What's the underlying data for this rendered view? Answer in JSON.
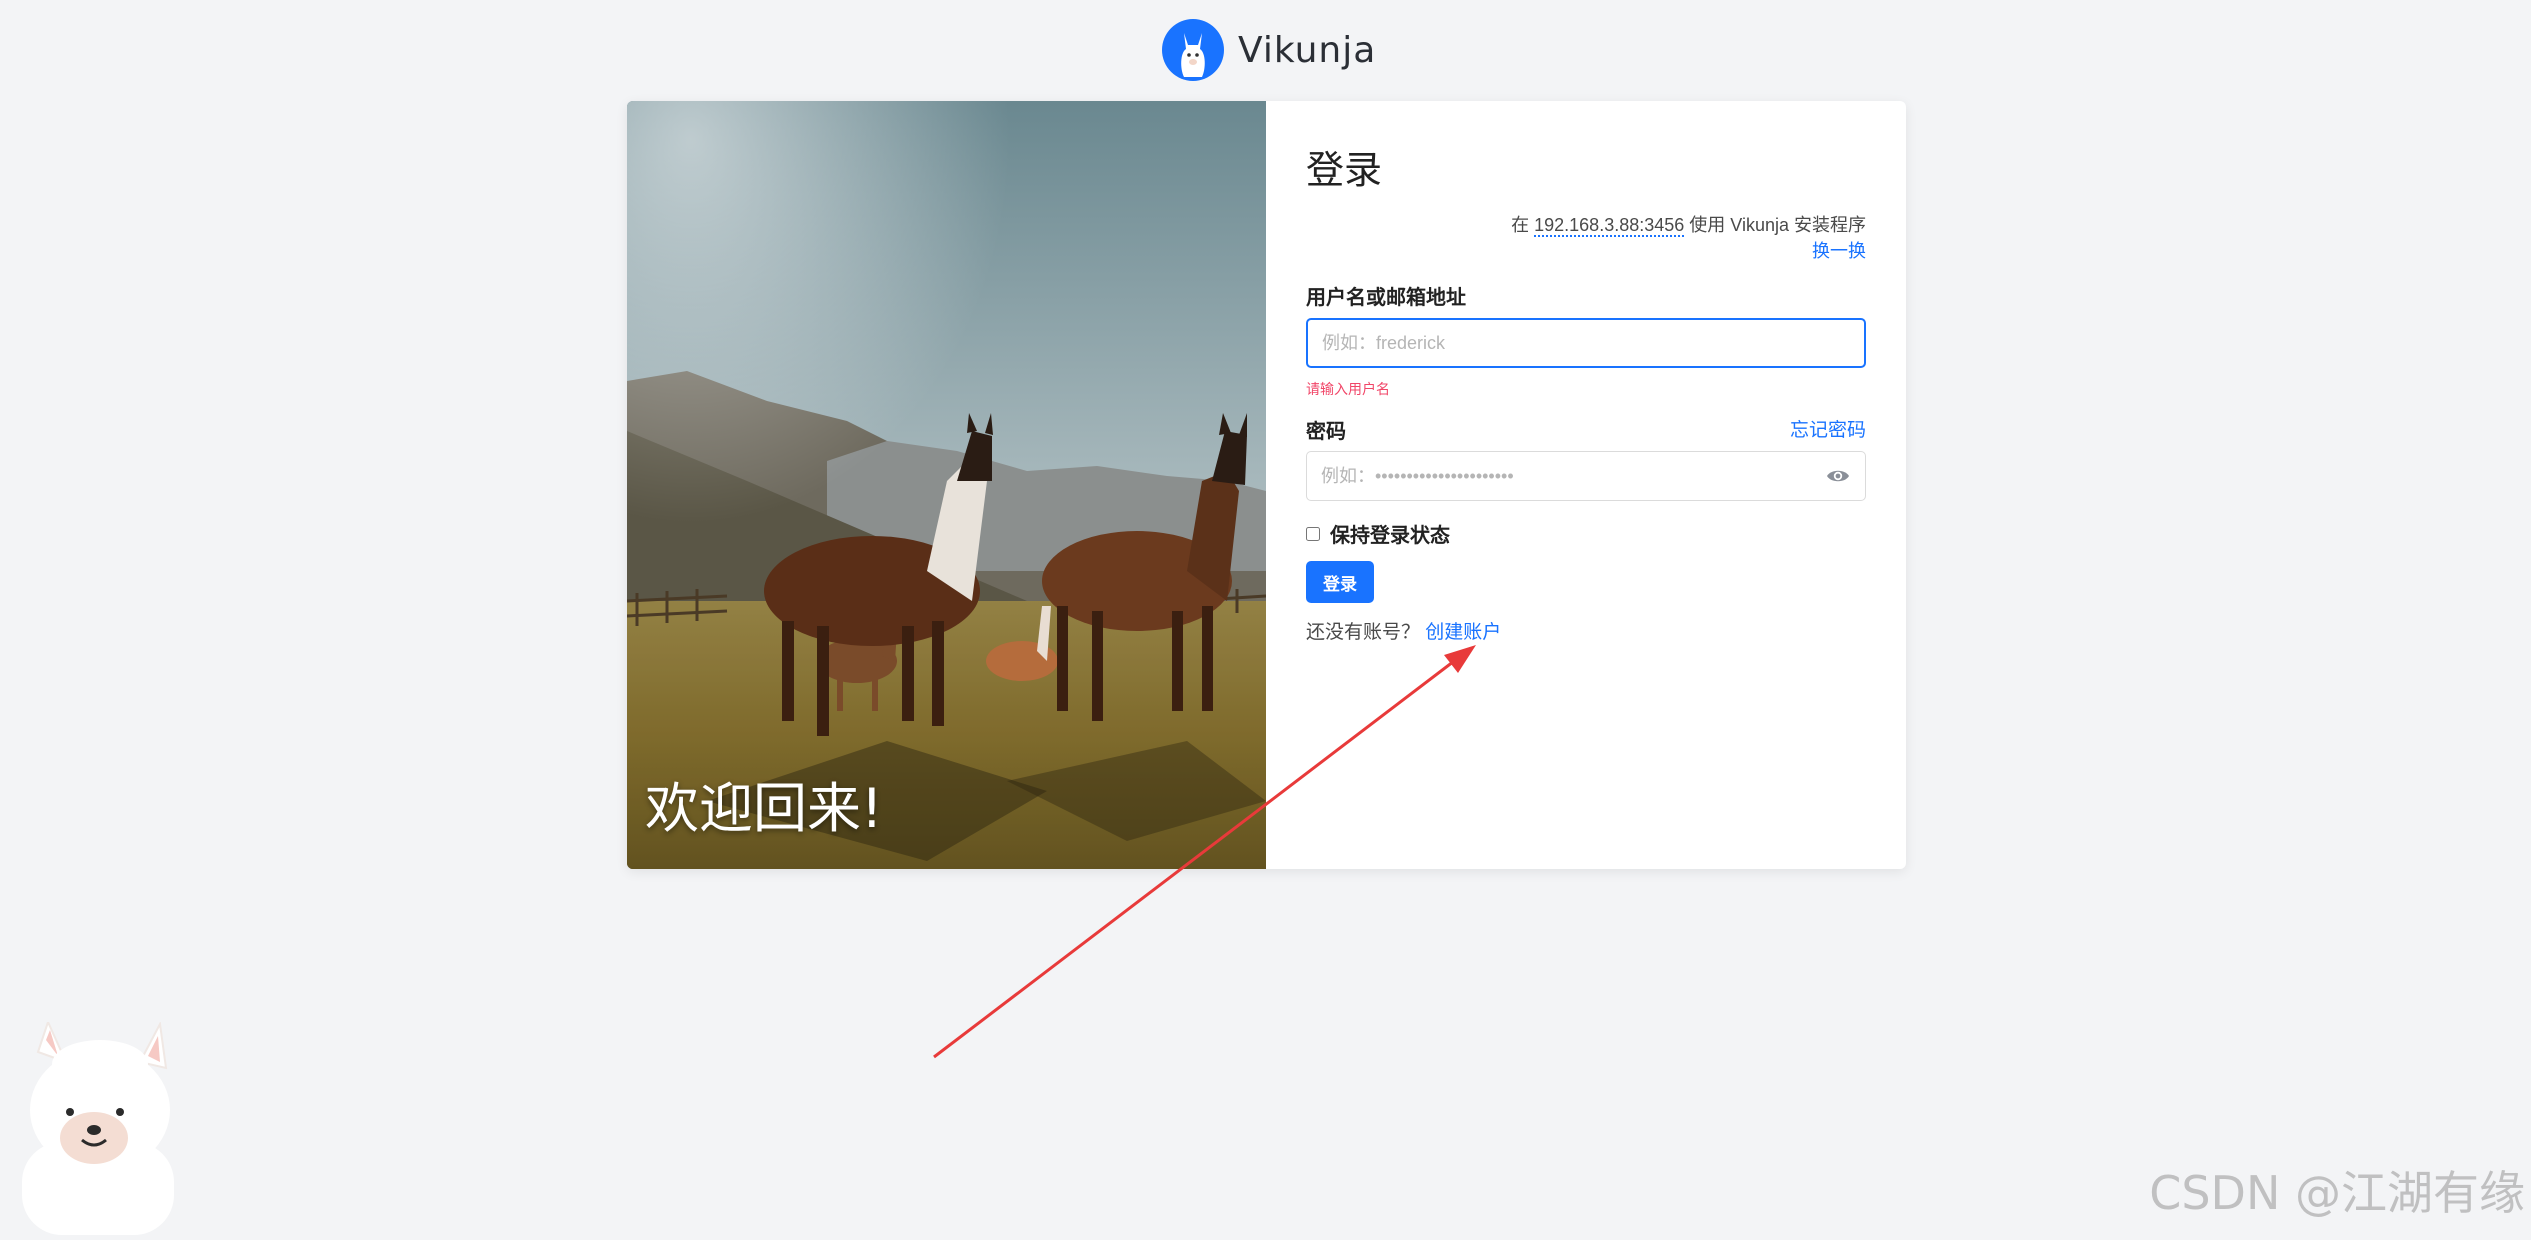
{
  "brand": {
    "name": "Vikunja",
    "logo_color": "#1973ff"
  },
  "hero": {
    "welcome_text": "欢迎回来!"
  },
  "login": {
    "title": "登录",
    "server_prefix": "在 ",
    "server_address": "192.168.3.88:3456",
    "server_suffix": " 使用 Vikunja 安装程序",
    "change_server": "换一换",
    "username_label": "用户名或邮箱地址",
    "username_placeholder": "例如：frederick",
    "username_error": "请输入用户名",
    "password_label": "密码",
    "forgot_password": "忘记密码",
    "password_placeholder": "例如：••••••••••••••••••••••",
    "password_toggle_icon": "eye-icon",
    "remember_label": "保持登录状态",
    "remember_checked": false,
    "submit_label": "登录",
    "no_account_text": "还没有账号？",
    "create_account": "创建账户"
  },
  "colors": {
    "accent": "#1973ff",
    "error": "#f14668",
    "background": "#f3f4f6",
    "annotation_arrow": "#e83a3a"
  },
  "watermark": {
    "text": "CSDN @江湖有缘"
  }
}
